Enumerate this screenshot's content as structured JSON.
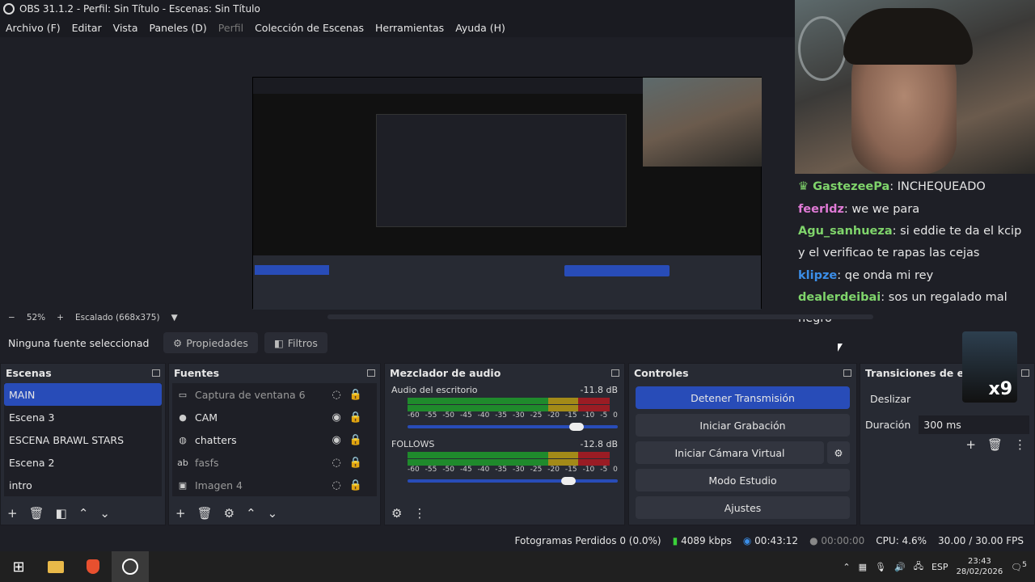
{
  "window": {
    "title": "OBS 31.1.2 - Perfil: Sin Título - Escenas: Sin Título"
  },
  "menu": [
    "Archivo (F)",
    "Editar",
    "Vista",
    "Paneles (D)",
    "Perfil",
    "Colección de Escenas",
    "Herramientas",
    "Ayuda (H)"
  ],
  "chat": [
    {
      "user": "GastezeePa",
      "msg": ": INCHEQUEADO",
      "color": "#7fd46b"
    },
    {
      "user": "feerldz",
      "msg": ": we we para",
      "color": "#e07ad6"
    },
    {
      "user": "Agu_sanhueza",
      "msg": ": si eddie te da el kcip y el verificao te rapas las cejas",
      "color": "#7fd46b"
    },
    {
      "user": "klipze",
      "msg": ": qe onda mi rey",
      "color": "#3b8ee8"
    },
    {
      "user": "dealerdeibai",
      "msg": ": sos un regalado mal negro",
      "color": "#7fd46b"
    }
  ],
  "zoom": {
    "minus": "−",
    "value": "52%",
    "plus": "+",
    "scale": "Escalado (668x375)"
  },
  "sourcebar": {
    "nosel": "Ninguna fuente seleccionad",
    "props": "Propiedades",
    "filters": "Filtros"
  },
  "scenes": {
    "title": "Escenas",
    "items": [
      "MAIN",
      "Escena 3",
      "ESCENA BRAWL STARS",
      "Escena 2",
      "intro"
    ]
  },
  "sources": {
    "title": "Fuentes",
    "items": [
      {
        "label": "Captura de ventana 6",
        "icon": "▭"
      },
      {
        "label": "CAM",
        "icon": "●"
      },
      {
        "label": "chatters",
        "icon": "◍"
      },
      {
        "label": "fasfs",
        "icon": "ab"
      },
      {
        "label": "Imagen 4",
        "icon": "▣"
      }
    ]
  },
  "mixer": {
    "title": "Mezclador de audio",
    "tracks": [
      {
        "name": "Audio del escritorio",
        "db": "-11.8 dB",
        "level": 0.84
      },
      {
        "name": "FOLLOWS",
        "db": "-12.8 dB",
        "level": 0.8
      }
    ],
    "ticks": [
      "-60",
      "-55",
      "-50",
      "-45",
      "-40",
      "-35",
      "-30",
      "-25",
      "-20",
      "-15",
      "-10",
      "-5",
      "0"
    ]
  },
  "controls": {
    "title": "Controles",
    "stop": "Detener Transmisión",
    "rec": "Iniciar Grabación",
    "vcam": "Iniciar Cámara Virtual",
    "studio": "Modo Estudio",
    "settings": "Ajustes"
  },
  "transitions": {
    "title": "Transiciones de esc",
    "selected": "Deslizar",
    "duration_label": "Duración",
    "duration": "300 ms"
  },
  "status": {
    "frames": "Fotogramas Perdidos 0 (0.0%)",
    "kbps": "4089 kbps",
    "live": "00:43:12",
    "rec": "00:00:00",
    "cpu": "CPU: 4.6%",
    "fps": "30.00 / 30.00 FPS"
  },
  "taskbar": {
    "lang": "ESP",
    "time": "23:43",
    "date": "28/02/2026",
    "notif": "5"
  },
  "overlay": {
    "x9": "x9"
  }
}
